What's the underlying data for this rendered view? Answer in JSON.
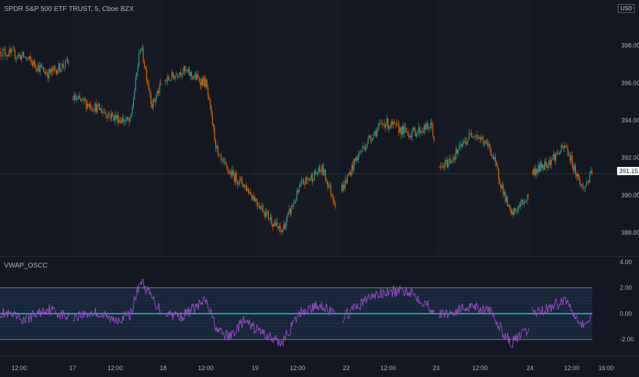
{
  "header": {
    "symbol_title": "SPDR S&P 500 ETF TRUST, 5, Cboe BZX",
    "currency": "USD",
    "last_price": "391.15"
  },
  "indicator": {
    "name": "VWAP_OSCC"
  },
  "price_axis": {
    "ticks": [
      "398.00",
      "396.00",
      "394.00",
      "392.00",
      "390.00",
      "388.00"
    ]
  },
  "osc_axis": {
    "ticks": [
      "4.00",
      "2.00",
      "0.00",
      "-2.00"
    ]
  },
  "time_axis": {
    "ticks": [
      "12:00",
      "17",
      "12:00",
      "18",
      "12:00",
      "19",
      "12:00",
      "22",
      "12:00",
      "23",
      "12:00",
      "24",
      "12:00",
      "16:00"
    ]
  },
  "colors": {
    "background": "#131722",
    "up_candle": "#26a69a",
    "down_candle": "#ef6c00",
    "oscillator": "#9c4dcc",
    "zero_line": "#26c6da",
    "band_line": "#b2b5be",
    "price_line": "#7a6a3a"
  },
  "chart_data": [
    {
      "type": "candlestick",
      "title": "SPDR S&P 500 ETF TRUST, 5, Cboe BZX",
      "x": [
        "16 11:00",
        "16 12:00",
        "16 13:00",
        "16 14:00",
        "17 10:00",
        "17 11:00",
        "17 12:00",
        "17 13:00",
        "17 14:00",
        "18 10:00",
        "18 11:00",
        "18 12:00",
        "18 13:00",
        "18 14:00",
        "18 15:00",
        "19 11:00",
        "19 12:00",
        "19 13:00",
        "19 14:00",
        "19 15:00",
        "22 10:00",
        "22 11:00",
        "22 12:00",
        "22 13:00",
        "22 14:00",
        "22 15:00",
        "23 10:00",
        "23 11:00",
        "23 12:00",
        "23 13:00",
        "23 14:00",
        "23 15:00",
        "24 11:00",
        "24 12:00",
        "24 13:00",
        "24 14:00",
        "24 15:00"
      ],
      "close": [
        397.7,
        397.4,
        396.5,
        397.1,
        395.2,
        394.7,
        394.2,
        393.9,
        398.1,
        394.8,
        395.9,
        396.7,
        396.0,
        392.0,
        391.2,
        390.6,
        388.0,
        390.6,
        391.4,
        389.5,
        390.4,
        392.0,
        393.1,
        393.9,
        393.3,
        393.7,
        391.3,
        392.0,
        393.4,
        392.5,
        388.9,
        390.0,
        391.2,
        391.8,
        392.6,
        390.3,
        391.2
      ],
      "ylim": [
        386.9,
        400.0
      ],
      "last_price": 391.15
    },
    {
      "type": "line",
      "title": "VWAP_OSCC",
      "x": [
        "16 11:00",
        "16 12:00",
        "16 13:00",
        "16 14:00",
        "17 10:00",
        "17 11:00",
        "17 12:00",
        "17 13:00",
        "17 14:00",
        "18 10:00",
        "18 11:00",
        "18 12:00",
        "18 13:00",
        "18 14:00",
        "18 15:00",
        "19 11:00",
        "19 12:00",
        "19 13:00",
        "19 14:00",
        "19 15:00",
        "22 10:00",
        "22 11:00",
        "22 12:00",
        "22 13:00",
        "22 14:00",
        "22 15:00",
        "23 10:00",
        "23 11:00",
        "23 12:00",
        "23 13:00",
        "23 14:00",
        "23 15:00",
        "24 11:00",
        "24 12:00",
        "24 13:00",
        "24 14:00",
        "24 15:00"
      ],
      "values": [
        0.1,
        -0.5,
        0.4,
        -0.3,
        -0.2,
        0.1,
        -0.5,
        -0.1,
        2.6,
        1.2,
        0.2,
        -0.2,
        1.0,
        -1.4,
        -1.8,
        -0.6,
        -2.3,
        0.2,
        0.7,
        -0.2,
        -0.3,
        0.5,
        1.3,
        1.6,
        1.8,
        0.4,
        -0.1,
        0.1,
        0.7,
        0.1,
        -2.3,
        -1.2,
        0.1,
        0.4,
        1.1,
        -0.9,
        -0.2
      ],
      "bands": [
        2.0,
        0.0,
        -2.0
      ],
      "ylim": [
        -3.1,
        4.1
      ]
    }
  ]
}
